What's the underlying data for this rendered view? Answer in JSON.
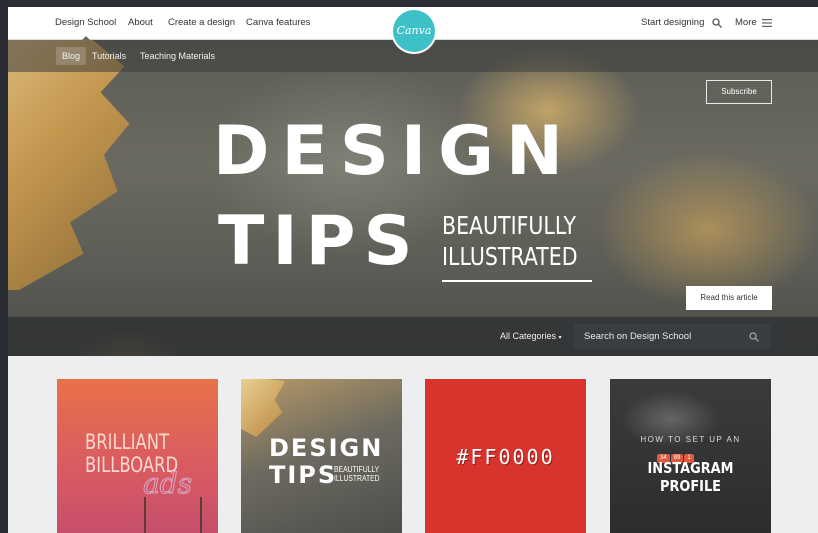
{
  "top_nav": {
    "links": [
      "Design School",
      "About",
      "Create a design",
      "Canva features"
    ],
    "logo_text": "Canva",
    "start_designing": "Start designing",
    "more": "More"
  },
  "sub_nav": {
    "links": [
      "Blog",
      "Tutorials",
      "Teaching Materials"
    ]
  },
  "hero": {
    "subscribe": "Subscribe",
    "title_line1": "DESIGN",
    "title_line2": "TIPS",
    "subtitle_line1": "BEAUTIFULLY",
    "subtitle_line2": "ILLUSTRATED",
    "read_button": "Read this article"
  },
  "search_bar": {
    "categories": "All Categories",
    "placeholder": "Search on Design School"
  },
  "cards": {
    "c1": {
      "line1": "BRILLIANT",
      "line2": "BILLBOARD",
      "line3": "ads"
    },
    "c2": {
      "line1": "DESIGN",
      "line2": "TIPS",
      "line3": "BEAUTIFULLY",
      "line4": "ILLUSTRATED"
    },
    "c3": {
      "text": "#FF0000"
    },
    "c4": {
      "line1": "HOW TO SET UP AN",
      "line2": "INSTAGRAM PROFILE",
      "badge1": "34",
      "badge2": "89",
      "badge3": "1"
    }
  },
  "colors": {
    "brand_teal": "#3ec0c7",
    "card_red": "#d8332c"
  }
}
